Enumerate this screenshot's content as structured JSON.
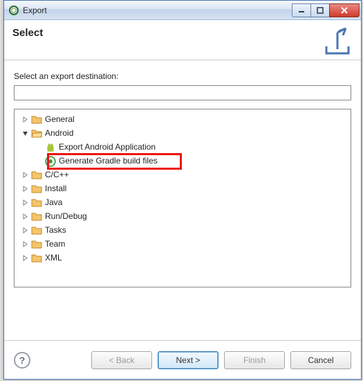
{
  "window": {
    "title": "Export"
  },
  "header": {
    "title": "Select"
  },
  "form": {
    "destination_label": "Select an export destination:",
    "destination_value": ""
  },
  "tree": {
    "general": "General",
    "android": "Android",
    "export_android_app": "Export Android Application",
    "generate_gradle": "Generate Gradle build files",
    "cpp": "C/C++",
    "install": "Install",
    "java": "Java",
    "rundebug": "Run/Debug",
    "tasks": "Tasks",
    "team": "Team",
    "xml": "XML"
  },
  "buttons": {
    "back": "< Back",
    "next": "Next >",
    "finish": "Finish",
    "cancel": "Cancel"
  }
}
